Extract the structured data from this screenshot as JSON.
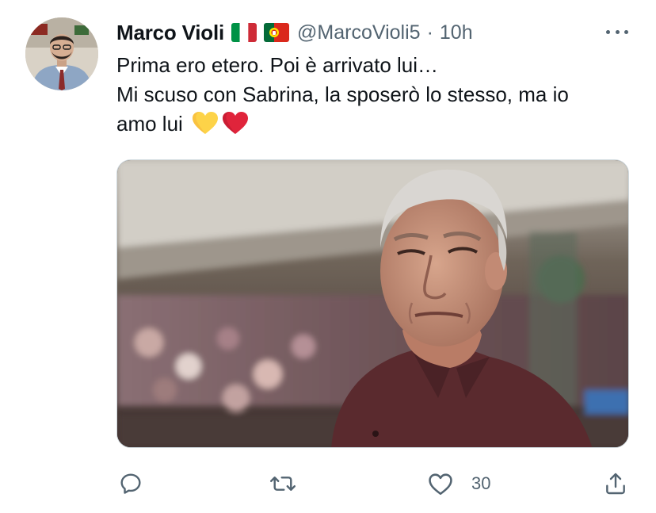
{
  "tweet": {
    "author": {
      "display_name": "Marco Violi",
      "handle": "@MarcoVioli5",
      "flags": [
        "italy-flag-icon",
        "portugal-flag-icon"
      ]
    },
    "separator": "·",
    "time": "10h",
    "text_lines": [
      "Prima ero etero. Poi è arrivato lui…",
      "Mi scuso con Sabrina, la sposerò lo stesso, ma io",
      "amo lui"
    ],
    "emoji": [
      "yellow-heart-icon",
      "red-heart-icon"
    ],
    "actions": {
      "reply": {
        "icon": "reply-icon"
      },
      "retweet": {
        "icon": "retweet-icon"
      },
      "like": {
        "icon": "like-icon",
        "count": "30"
      },
      "share": {
        "icon": "share-icon"
      }
    },
    "colors": {
      "text": "#0f1419",
      "secondary": "#536471",
      "border": "#cfd9de",
      "yellow_heart": "#fdd348",
      "red_heart": "#e0243b"
    }
  }
}
